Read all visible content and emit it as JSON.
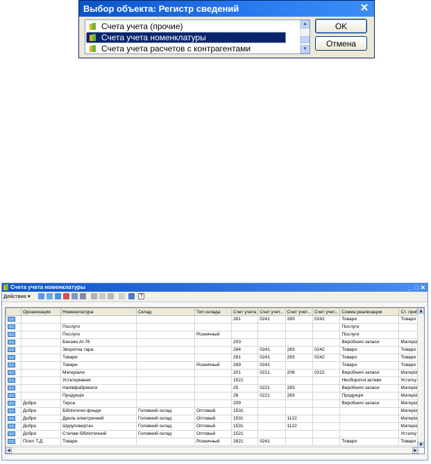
{
  "dialog": {
    "title": "Выбор объекта: Регистр сведений",
    "close": "✕",
    "items": [
      {
        "label": "Счета учета (прочие)"
      },
      {
        "label": "Счета учета номенклатуры"
      },
      {
        "label": "Счета учета расчетов с контрагентами"
      }
    ],
    "ok": "OK",
    "cancel": "Отмена"
  },
  "window": {
    "title": "Счета учета номенклатуры",
    "minimize": "_",
    "maximize": "□",
    "close": "✕",
    "actions_label": "Действия ▾",
    "toolbar_icons": [
      "add-icon",
      "copy-icon",
      "add-group-icon",
      "delete-icon",
      "edit-icon",
      "report-icon",
      "filter-icon",
      "filter-off-icon",
      "sort-icon",
      "sort-off-icon",
      "refresh-icon",
      "help-icon"
    ],
    "help_label": "?"
  },
  "table": {
    "columns": [
      "",
      "Организация",
      "Номенклатура",
      "Склад",
      "Тип склада",
      "Счет учета",
      "Счет учет...",
      "Счет учет...",
      "Счет учет...",
      "Схема реализации",
      "Ст. приб"
    ],
    "rows": [
      [
        "",
        "",
        "",
        "",
        "281",
        "0241",
        "283",
        "0242",
        "Товари",
        "Товари"
      ],
      [
        "",
        "Послуги",
        "",
        "",
        "",
        "",
        "",
        "",
        "Послуги",
        ""
      ],
      [
        "",
        "Послуги",
        "",
        "Розничный",
        "",
        "",
        "",
        "",
        "Послуги",
        ""
      ],
      [
        "",
        "Бензин АІ-76",
        "",
        "",
        "203",
        "",
        "",
        "",
        "Виробничі запаси",
        "Матеріа"
      ],
      [
        "",
        "Зворотна тара",
        "",
        "",
        "284",
        "0241",
        "283",
        "0242",
        "Товари",
        "Товари"
      ],
      [
        "",
        "Товари",
        "",
        "",
        "281",
        "0241",
        "283",
        "0242",
        "Товари",
        "Товари"
      ],
      [
        "",
        "Товари",
        "",
        "Розничный",
        "289",
        "0241",
        "",
        "",
        "Товари",
        "Товари"
      ],
      [
        "",
        "Матеріали",
        "",
        "",
        "201",
        "0221",
        "206",
        "0222",
        "Виробничі запаси",
        "Матеріа"
      ],
      [
        "",
        "Устаткування",
        "",
        "",
        "1521",
        "",
        "",
        "",
        "Необоротні активи",
        "Устатку"
      ],
      [
        "",
        "Напівфабрикати",
        "",
        "",
        "25",
        "0221",
        "283",
        "",
        "Виробничі запаси",
        "Матеріа"
      ],
      [
        "",
        "Продукція",
        "",
        "",
        "26",
        "0221",
        "283",
        "",
        "Продукція",
        "Матеріа"
      ],
      [
        "Добро",
        "Тирса",
        "",
        "",
        "209",
        "",
        "",
        "",
        "Виробничі запаси",
        "Матеріа"
      ],
      [
        "Добро",
        "Бібліотечні фонди",
        "Головний склад",
        "Оптовый",
        "1531",
        "",
        "",
        "",
        "",
        "Матеріа"
      ],
      [
        "Добро",
        "Дриль електричний",
        "Головний склад",
        "Оптовый",
        "1531",
        "",
        "1122",
        "",
        "",
        "Матеріа"
      ],
      [
        "Добро",
        "Шуруповертач",
        "Головний склад",
        "Оптовый",
        "1531",
        "",
        "1122",
        "",
        "",
        "Матеріа"
      ],
      [
        "Добро",
        "Стелаж бібліотечний",
        "Головний склад",
        "Оптовый",
        "1521",
        "",
        "",
        "",
        "",
        "Устатку"
      ],
      [
        "Пілот Т.Д",
        "Товари",
        "",
        "Розничный",
        "2821",
        "0241",
        "",
        "",
        "Товари",
        "Товари"
      ]
    ]
  }
}
